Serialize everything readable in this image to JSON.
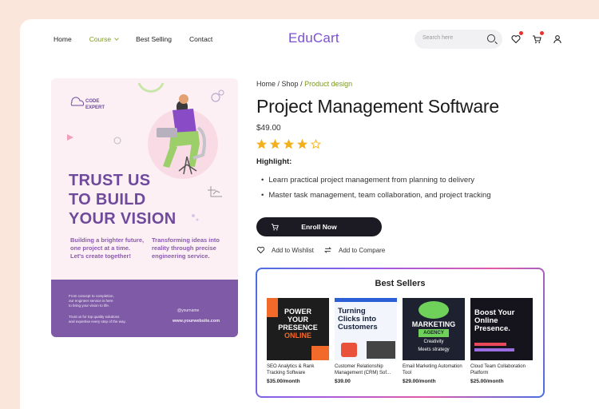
{
  "nav": {
    "home": "Home",
    "course": "Course",
    "best_selling": "Best Selling",
    "contact": "Contact"
  },
  "logo": "EduCart",
  "search": {
    "placeholder": "Search here"
  },
  "poster": {
    "brand_line1": "CODE",
    "brand_line2": "EXPERT",
    "headline1": "TRUST US",
    "headline2": "TO BUILD",
    "headline3": "YOUR VISION",
    "left_text": [
      "Building a brighter future,",
      "one project at a time.",
      "Let's create together!"
    ],
    "right_text": [
      "Transforming ideas into",
      "reality through precise",
      "engineering service."
    ],
    "foot_text1": [
      "From concept to completion,",
      "our engineer service is here",
      "to bring your vision to life."
    ],
    "foot_text2": [
      "Trust us for top quality solutions",
      "and expertise every step of the way."
    ],
    "social": "@yourname",
    "website": "www.yourwebsite.com"
  },
  "breadcrumb": {
    "home": "Home",
    "shop": "Shop",
    "current": "Product design",
    "sep": " / "
  },
  "product": {
    "title": "Project Management Software",
    "price": "$49.00",
    "rating": 4,
    "rating_max": 5,
    "highlight_label": "Highlight:",
    "bullets": [
      "Learn practical project management from planning to delivery",
      "Master task management, team collaboration, and project tracking"
    ],
    "enroll": "Enroll Now",
    "wishlist": "Add to Wishlist",
    "compare": "Add to Compare"
  },
  "best_sellers": {
    "heading": "Best Sellers",
    "items": [
      {
        "name": "SEO Analytics & Rank Tracking Software",
        "price": "$35.00/month",
        "thumb": [
          "POWER",
          "YOUR",
          "PRESENCE",
          "ONLINE"
        ]
      },
      {
        "name": "Customer Relationship Management (CRM) Sof...",
        "price": "$39.00",
        "thumb": [
          "Turning",
          "Clicks into",
          "Customers"
        ]
      },
      {
        "name": "Email Marketing Automation Tool",
        "price": "$29.00/month",
        "thumb": [
          "MARKETING",
          "AGENCY",
          "Creativity",
          "Meets strategy"
        ]
      },
      {
        "name": "Cloud Team Collaboration Platform",
        "price": "$25.00/month",
        "thumb": [
          "Boost Your",
          "Online",
          "Presence."
        ]
      }
    ]
  },
  "colors": {
    "accent": "#7b4fd6",
    "active": "#7a9a1a",
    "star": "#f2b01e",
    "poster_purple": "#7f5aa6"
  }
}
